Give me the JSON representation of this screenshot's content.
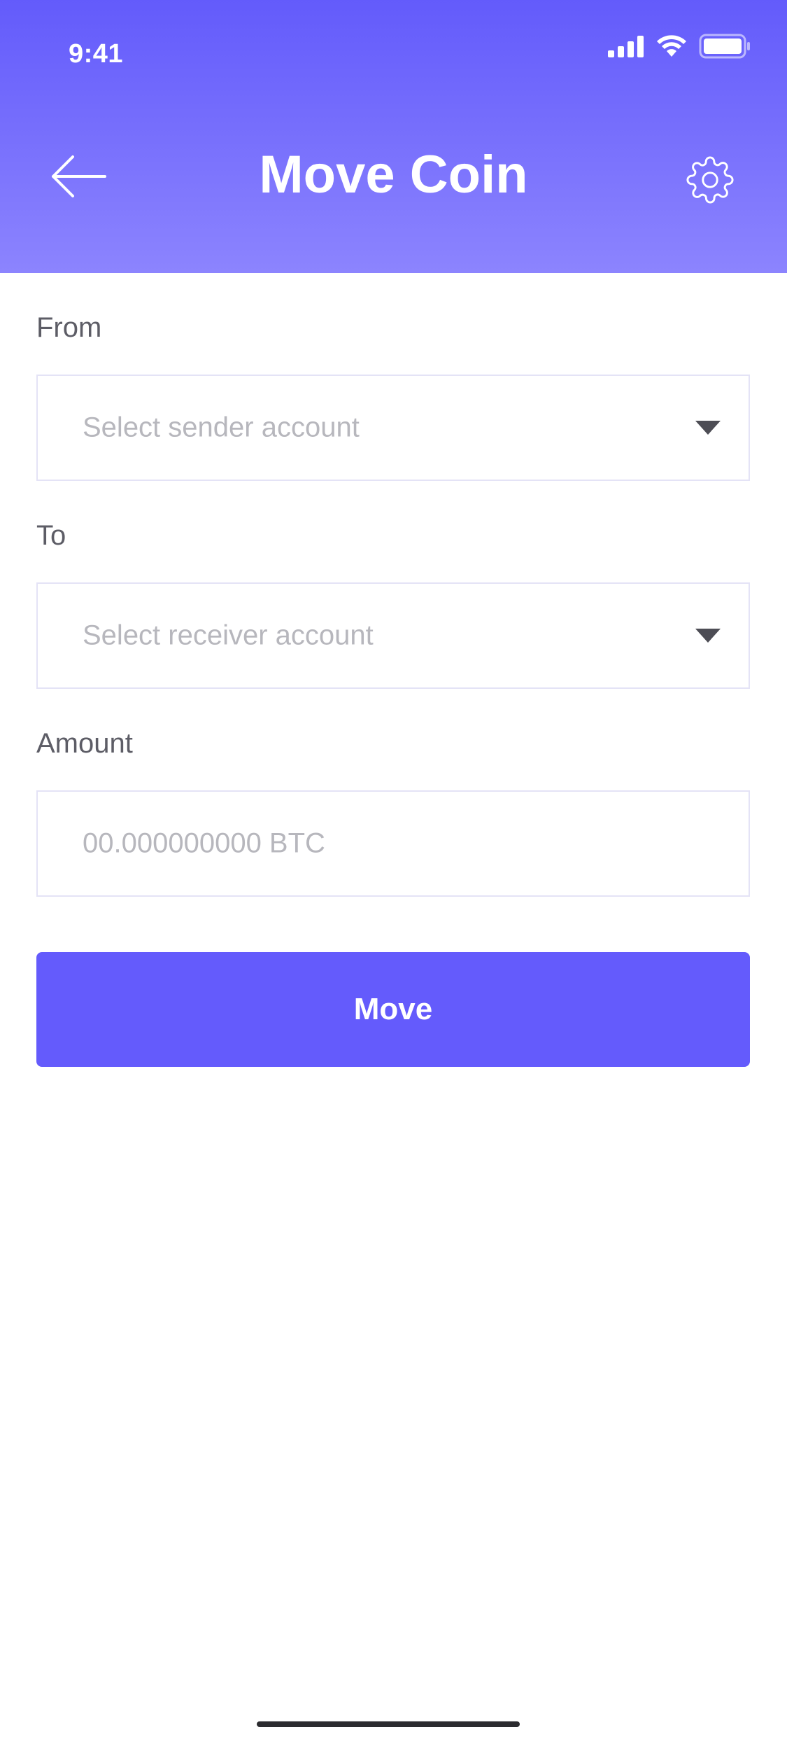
{
  "status_bar": {
    "time": "9:41"
  },
  "header": {
    "title": "Move Coin",
    "back_icon": "arrow-left-icon",
    "settings_icon": "gear-icon"
  },
  "form": {
    "from_label": "From",
    "from_placeholder": "Select sender account",
    "to_label": "To",
    "to_placeholder": "Select receiver account",
    "amount_label": "Amount",
    "amount_placeholder": "00.000000000 BTC",
    "submit_label": "Move"
  },
  "colors": {
    "header_gradient_top": "#635bfb",
    "header_gradient_bottom": "#8c84fe",
    "accent": "#645bfc",
    "label_text": "#5d5d66",
    "placeholder_text": "#b7b7bd",
    "field_border": "#e4e3f6"
  }
}
